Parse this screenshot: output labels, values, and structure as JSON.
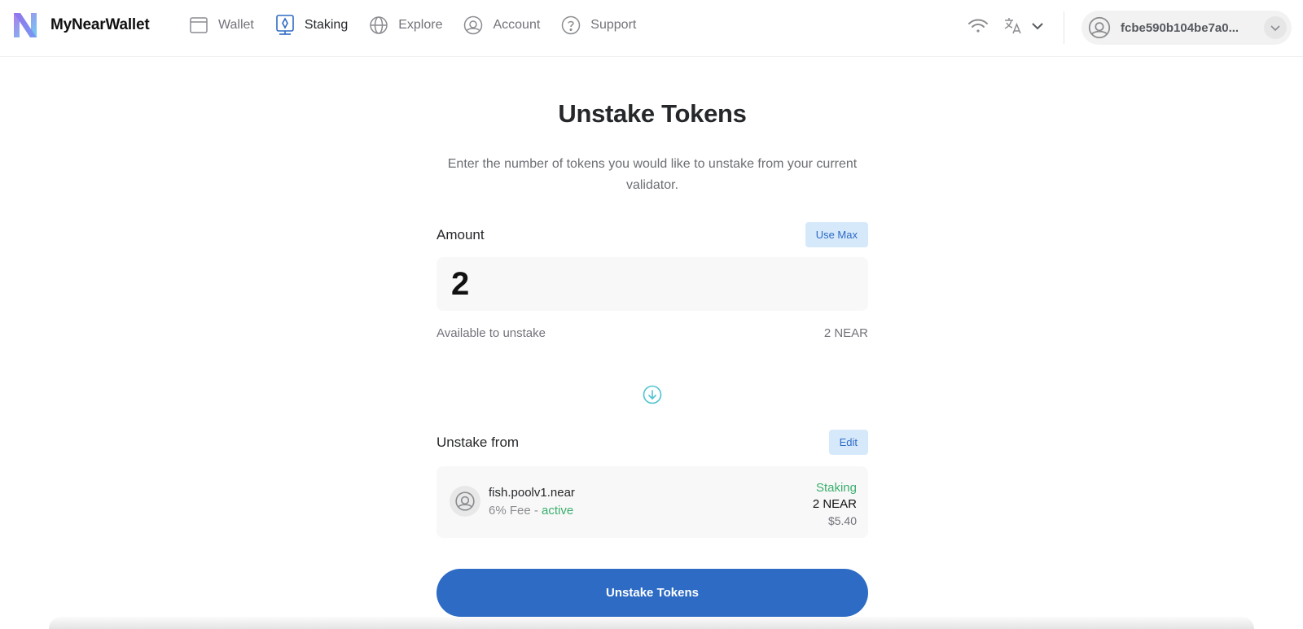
{
  "header": {
    "brand": "MyNearWallet",
    "nav": [
      {
        "label": "Wallet",
        "icon": "wallet-icon",
        "active": false
      },
      {
        "label": "Staking",
        "icon": "staking-icon",
        "active": true
      },
      {
        "label": "Explore",
        "icon": "globe-icon",
        "active": false
      },
      {
        "label": "Account",
        "icon": "account-icon",
        "active": false
      },
      {
        "label": "Support",
        "icon": "help-icon",
        "active": false
      }
    ],
    "account_id": "fcbe590b104be7a0...",
    "icons": [
      "wifi-icon",
      "translate-icon",
      "chevron-down-icon",
      "avatar-icon"
    ]
  },
  "page": {
    "title": "Unstake Tokens",
    "description": "Enter the number of tokens you would like to unstake from your current validator."
  },
  "amount": {
    "label": "Amount",
    "use_max_label": "Use Max",
    "value": "2",
    "available_label": "Available to unstake",
    "available_value": "2 NEAR"
  },
  "unstake_from": {
    "label": "Unstake from",
    "edit_label": "Edit",
    "validator": {
      "name": "fish.poolv1.near",
      "fee_text": "6% Fee - ",
      "status_text": "active",
      "staking_label": "Staking",
      "amount": "2 NEAR",
      "usd": "$5.40"
    }
  },
  "submit_label": "Unstake Tokens",
  "colors": {
    "primary": "#2d6bc4",
    "light_blue": "#d6e9fb",
    "green": "#3bae6d",
    "teal_icon": "#4cc3d1"
  }
}
